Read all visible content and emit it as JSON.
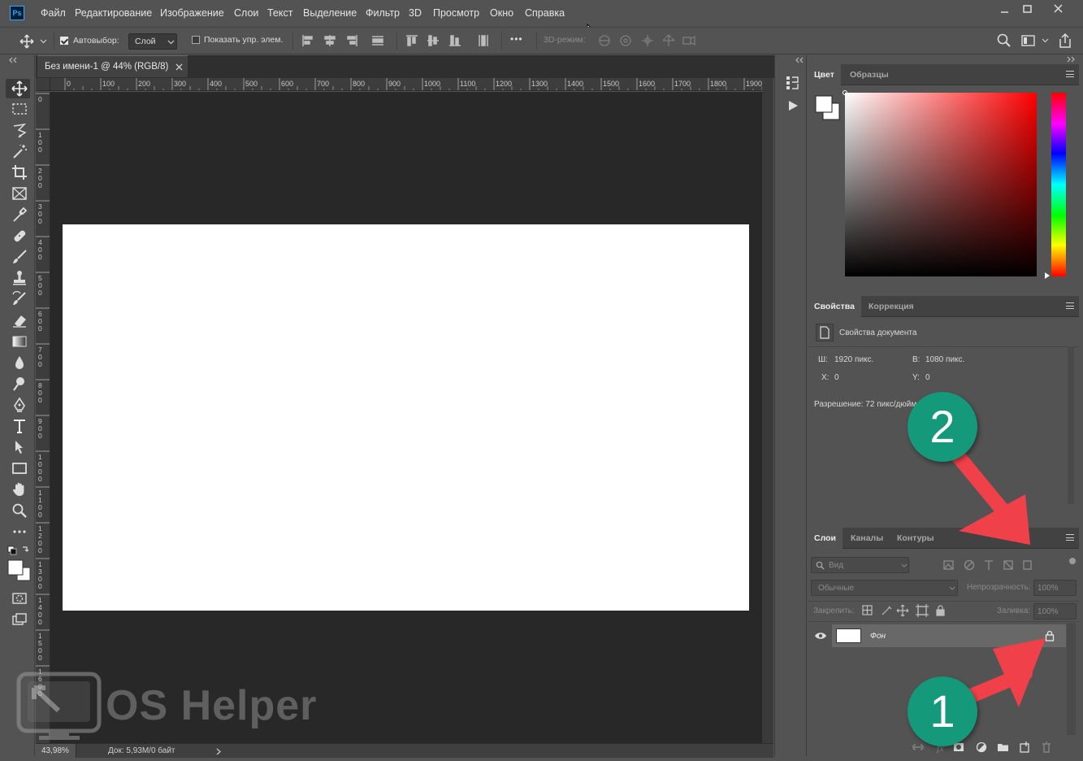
{
  "app": {
    "logo_text": "Ps"
  },
  "menu": [
    "Файл",
    "Редактирование",
    "Изображение",
    "Слои",
    "Текст",
    "Выделение",
    "Фильтр",
    "3D",
    "Просмотр",
    "Окно",
    "Справка"
  ],
  "options_bar": {
    "autoselect_label": "Автовыбор:",
    "autoselect_checked": true,
    "autoselect_target": "Слой",
    "show_transform_label": "Показать упр. элем.",
    "show_transform_checked": false,
    "more_label": "•••",
    "mode_3d_label": "3D-режим:"
  },
  "document": {
    "tab_title": "Без имени-1 @ 44% (RGB/8)",
    "zoom": "43,98%",
    "doc_info": "Док: 5,93M/0 байт",
    "ruler_h_labels": [
      "0",
      "100",
      "200",
      "300",
      "400",
      "500",
      "600",
      "700",
      "800",
      "900",
      "1000",
      "1100",
      "1200",
      "1300",
      "1400",
      "1500",
      "1600",
      "1700",
      "1800",
      "1900"
    ],
    "ruler_v_labels": [
      "0",
      "100",
      "200",
      "300",
      "400",
      "500",
      "600",
      "700",
      "800",
      "900",
      "1000",
      "1100",
      "1200",
      "1300",
      "1400",
      "1500",
      "1600"
    ]
  },
  "color_panel": {
    "tabs": [
      "Цвет",
      "Образцы"
    ]
  },
  "properties_panel": {
    "tabs": [
      "Свойства",
      "Коррекция"
    ],
    "title": "Свойства документа",
    "w_label": "Ш:",
    "w_value": "1920 пикс.",
    "h_label": "В:",
    "h_value": "1080 пикс.",
    "x_label": "X:",
    "x_value": "0",
    "y_label": "Y:",
    "y_value": "0",
    "resolution": "Разрешение: 72 пикс/дюйм"
  },
  "layers_panel": {
    "tabs": [
      "Слои",
      "Каналы",
      "Контуры"
    ],
    "filter_placeholder": "Вид",
    "blend_mode": "Обычные",
    "opacity_label": "Непрозрачность:",
    "opacity_value": "100%",
    "lock_label": "Закрепить:",
    "fill_label": "Заливка:",
    "fill_value": "100%",
    "layers": [
      {
        "name": "Фон",
        "visible": true,
        "locked": true
      }
    ]
  },
  "annotations": {
    "badge_1": "1",
    "badge_2": "2"
  },
  "watermark": {
    "text": "OS Helper"
  },
  "colors": {
    "accent": "#14997a",
    "arrow": "#f0404a",
    "ui_bg": "#535353",
    "canvas_bg": "#282828"
  }
}
